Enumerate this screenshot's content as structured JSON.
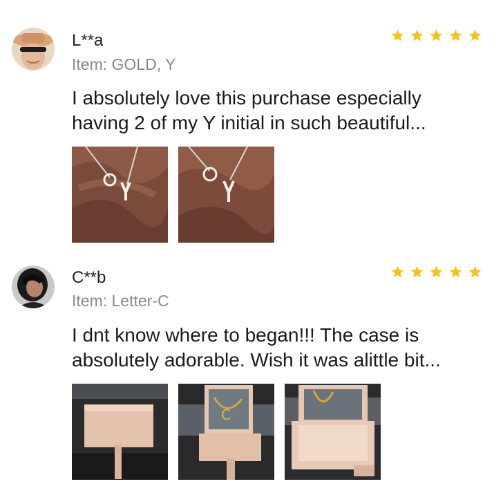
{
  "colors": {
    "star": "#f6c21b",
    "name": "#222222",
    "item": "#8a8a8a",
    "text": "#1a1a1a"
  },
  "reviews": [
    {
      "user": "L**a",
      "item": "Item: GOLD, Y",
      "rating": 5,
      "text_line1": "I absolutely love this purchase especially",
      "text_line2": "having 2 of my Y initial in such beautiful...",
      "photos": [
        "necklace-on-satin-photo",
        "necklace-on-satin-photo"
      ]
    },
    {
      "user": "C**b",
      "item": "Item: Letter-C",
      "rating": 5,
      "text_line1": "I dnt know where to began!!! The case is",
      "text_line2": "absolutely adorable. Wish it was alittle bit...",
      "photos": [
        "closed-gift-box-photo",
        "open-box-necklace-photo",
        "open-box-empty-photo"
      ]
    }
  ]
}
